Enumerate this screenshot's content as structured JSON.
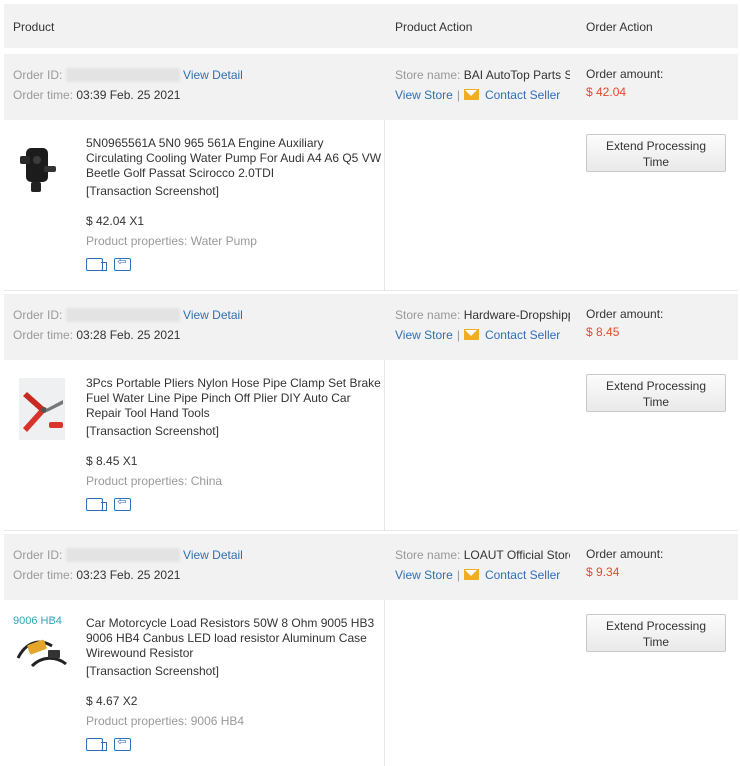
{
  "header": {
    "product": "Product",
    "product_action": "Product Action",
    "order_action": "Order Action"
  },
  "labels": {
    "order_id": "Order ID:",
    "view_detail": "View Detail",
    "order_time": "Order time:",
    "store_name": "Store name:",
    "view_store": "View Store",
    "contact_seller": "Contact Seller",
    "order_amount": "Order amount:",
    "transaction_screenshot": "[Transaction Screenshot]",
    "product_properties": "Product properties:",
    "extend_line1": "Extend Processing",
    "extend_line2": "Time",
    "pipe": "|"
  },
  "orders": [
    {
      "time": "03:39 Feb. 25 2021",
      "store": "BAI AutoTop Parts S",
      "amount": "$ 42.04",
      "title": "5N0965561A 5N0 965 561A Engine Auxiliary Circulating Cooling Water Pump For Audi A4 A6 Q5 VW Beetle Golf Passat Scirocco 2.0TDI",
      "price_qty": "$ 42.04 X1",
      "property": "Water Pump",
      "thumb_icon": "water-pump-product-image"
    },
    {
      "time": "03:28 Feb. 25 2021",
      "store": "Hardware-Dropshipp",
      "amount": "$ 8.45",
      "title": "3Pcs Portable Pliers Nylon Hose Pipe Clamp Set Brake Fuel Water Line Pipe Pinch Off Plier DIY Auto Car Repair Tool Hand Tools",
      "price_qty": "$ 8.45 X1",
      "property": "China",
      "thumb_icon": "pliers-product-image"
    },
    {
      "time": "03:23 Feb. 25 2021",
      "store": "LOAUT Official Store",
      "amount": "$ 9.34",
      "title": "Car Motorcycle Load Resistors 50W 8 Ohm 9005 HB3 9006 HB4 Canbus LED load resistor Aluminum Case Wirewound Resistor",
      "price_qty": "$ 4.67 X2",
      "property": "9006 HB4",
      "thumb_label": "9006 HB4",
      "thumb_icon": "resistor-product-image"
    }
  ],
  "colors": {
    "link": "#2e6fb5",
    "price": "#e24a2b",
    "header_bg": "#f2f2f2"
  }
}
